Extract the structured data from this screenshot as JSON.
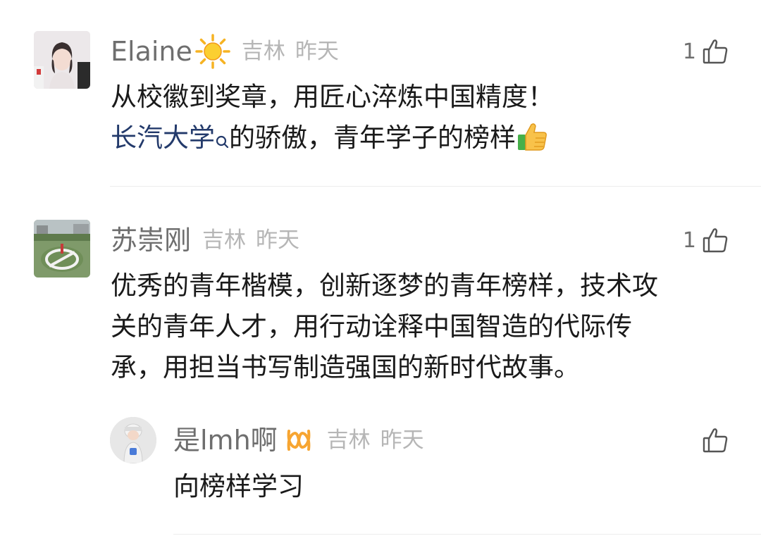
{
  "comments": [
    {
      "username": "Elaine",
      "badge_icon": "sun-icon",
      "location": "吉林",
      "time": "昨天",
      "likes": "1",
      "text_line1": "从校徽到奖章，用匠心淬炼中国精度！",
      "link_text": "长汽大学",
      "text_line2_rest": "的骄傲，青年学子的榜样"
    },
    {
      "username": "苏崇刚",
      "location": "吉林",
      "time": "昨天",
      "likes": "1",
      "text_line1": "优秀的青年楷模，创新逐梦的青年榜样，技术攻",
      "text_line2": "关的青年人才，用行动诠释中国智造的代际传",
      "text_line3": "承，用担当书写制造强国的新时代故事。"
    }
  ],
  "reply": {
    "username": "是lmh啊",
    "badge_icon": "infinity-icon",
    "location": "吉林",
    "time": "昨天",
    "text": "向榜样学习"
  },
  "colors": {
    "username": "#6e6e6e",
    "meta": "#b6b6b6",
    "link": "#233a6b",
    "badge_orange": "#f7a531"
  }
}
